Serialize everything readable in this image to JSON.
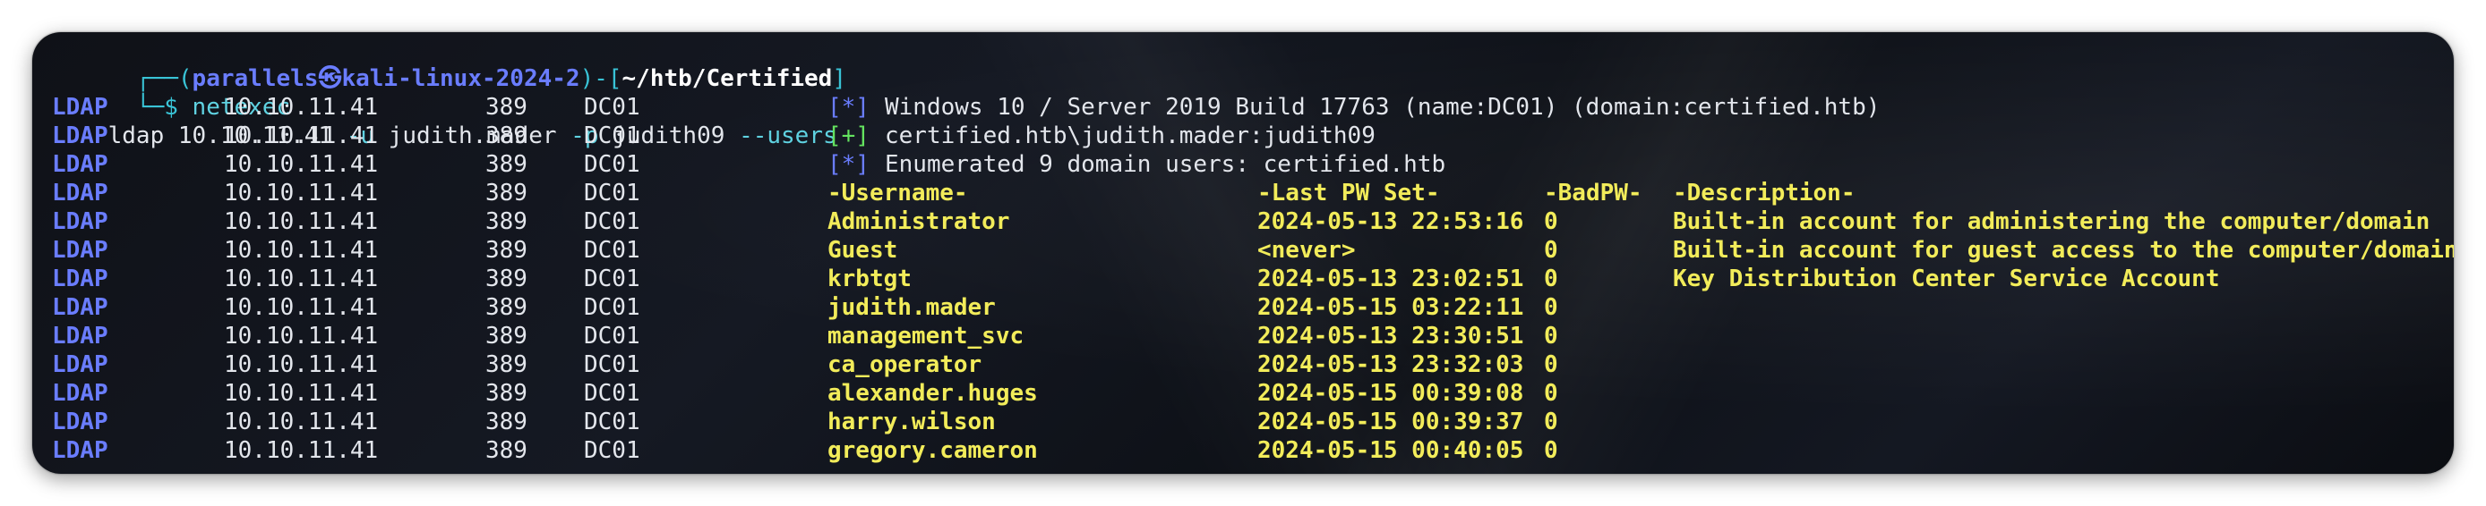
{
  "prompt": {
    "frame_open": "┌──(",
    "user": "parallels",
    "skull": "㉿",
    "host": "kali-linux-2024-2",
    "mid": ")-[",
    "path": "~/htb/Certified",
    "frame_close": "]",
    "line2_prefix": "└─$ ",
    "cmd": "netexec",
    "args": [
      {
        "text": "ldap 10.10.11.41 ",
        "kind": "arg"
      },
      {
        "text": "-u",
        "kind": "flag"
      },
      {
        "text": " judith.mader ",
        "kind": "arg"
      },
      {
        "text": "-p",
        "kind": "flag"
      },
      {
        "text": " judith09 ",
        "kind": "arg"
      },
      {
        "text": "--users",
        "kind": "flag"
      }
    ]
  },
  "rows": [
    {
      "proto": "LDAP",
      "ip": "10.10.11.41",
      "port": "389",
      "host": "DC01",
      "tag": "[*]",
      "tagKind": "b",
      "msg": "Windows 10 / Server 2019 Build 17763 (name:DC01) (domain:certified.htb)"
    },
    {
      "proto": "LDAP",
      "ip": "10.10.11.41",
      "port": "389",
      "host": "DC01",
      "tag": "[+]",
      "tagKind": "g",
      "msg": "certified.htb\\judith.mader:judith09"
    },
    {
      "proto": "LDAP",
      "ip": "10.10.11.41",
      "port": "389",
      "host": "DC01",
      "tag": "[*]",
      "tagKind": "b",
      "msg": "Enumerated 9 domain users: certified.htb"
    },
    {
      "proto": "LDAP",
      "ip": "10.10.11.41",
      "port": "389",
      "host": "DC01",
      "user": "-Username-",
      "pwset": "-Last PW Set-",
      "bad": "-BadPW-",
      "desc": "-Description-"
    },
    {
      "proto": "LDAP",
      "ip": "10.10.11.41",
      "port": "389",
      "host": "DC01",
      "user": "Administrator",
      "pwset": "2024-05-13 22:53:16",
      "bad": "0",
      "desc": "Built-in account for administering the computer/domain"
    },
    {
      "proto": "LDAP",
      "ip": "10.10.11.41",
      "port": "389",
      "host": "DC01",
      "user": "Guest",
      "pwset": "<never>",
      "bad": "0",
      "desc": "Built-in account for guest access to the computer/domain"
    },
    {
      "proto": "LDAP",
      "ip": "10.10.11.41",
      "port": "389",
      "host": "DC01",
      "user": "krbtgt",
      "pwset": "2024-05-13 23:02:51",
      "bad": "0",
      "desc": "Key Distribution Center Service Account"
    },
    {
      "proto": "LDAP",
      "ip": "10.10.11.41",
      "port": "389",
      "host": "DC01",
      "user": "judith.mader",
      "pwset": "2024-05-15 03:22:11",
      "bad": "0",
      "desc": ""
    },
    {
      "proto": "LDAP",
      "ip": "10.10.11.41",
      "port": "389",
      "host": "DC01",
      "user": "management_svc",
      "pwset": "2024-05-13 23:30:51",
      "bad": "0",
      "desc": ""
    },
    {
      "proto": "LDAP",
      "ip": "10.10.11.41",
      "port": "389",
      "host": "DC01",
      "user": "ca_operator",
      "pwset": "2024-05-13 23:32:03",
      "bad": "0",
      "desc": ""
    },
    {
      "proto": "LDAP",
      "ip": "10.10.11.41",
      "port": "389",
      "host": "DC01",
      "user": "alexander.huges",
      "pwset": "2024-05-15 00:39:08",
      "bad": "0",
      "desc": ""
    },
    {
      "proto": "LDAP",
      "ip": "10.10.11.41",
      "port": "389",
      "host": "DC01",
      "user": "harry.wilson",
      "pwset": "2024-05-15 00:39:37",
      "bad": "0",
      "desc": ""
    },
    {
      "proto": "LDAP",
      "ip": "10.10.11.41",
      "port": "389",
      "host": "DC01",
      "user": "gregory.cameron",
      "pwset": "2024-05-15 00:40:05",
      "bad": "0",
      "desc": ""
    }
  ]
}
